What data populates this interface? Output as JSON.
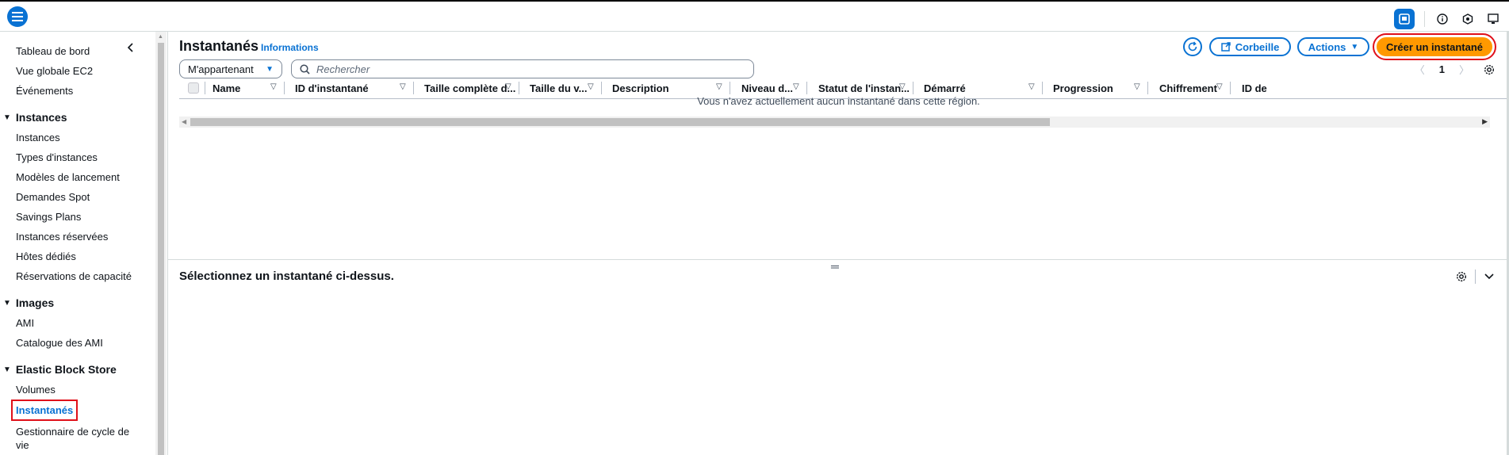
{
  "sidebar": {
    "top_items": [
      "Tableau de bord",
      "Vue globale EC2",
      "Événements"
    ],
    "sections": [
      {
        "title": "Instances",
        "items": [
          "Instances",
          "Types d'instances",
          "Modèles de lancement",
          "Demandes Spot",
          "Savings Plans",
          "Instances réservées",
          "Hôtes dédiés",
          "Réservations de capacité"
        ]
      },
      {
        "title": "Images",
        "items": [
          "AMI",
          "Catalogue des AMI"
        ]
      },
      {
        "title": "Elastic Block Store",
        "items": [
          "Volumes",
          "Instantanés",
          "Gestionnaire de cycle de vie"
        ]
      }
    ],
    "active": "Instantanés"
  },
  "header": {
    "title": "Instantanés",
    "info": "Informations",
    "trash_label": "Corbeille",
    "actions_label": "Actions",
    "create_label": "Créer un instantané"
  },
  "filter": {
    "owner_value": "M'appartenant",
    "search_placeholder": "Rechercher"
  },
  "pager": {
    "page": "1"
  },
  "table": {
    "columns": [
      "Name",
      "ID d'instantané",
      "Taille complète d...",
      "Taille du v...",
      "Description",
      "Niveau d...",
      "Statut de l'instan...",
      "Démarré",
      "Progression",
      "Chiffrement",
      "ID de"
    ],
    "empty_message": "Vous n'avez actuellement aucun instantané dans cette région."
  },
  "details": {
    "title": "Sélectionnez un instantané ci-dessus."
  },
  "colors": {
    "accent": "#0972d3",
    "primary": "#ff9900",
    "highlight": "#e0101a"
  }
}
